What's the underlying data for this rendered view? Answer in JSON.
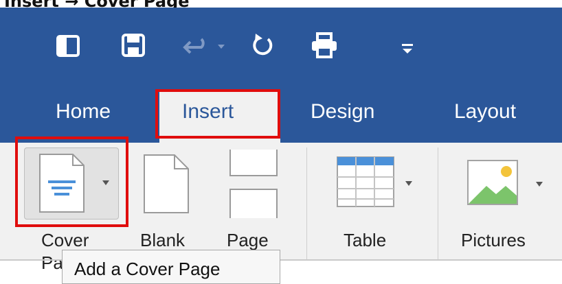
{
  "caption": "Insert → Cover Page",
  "quick_access": [
    "sidebar-icon",
    "save-icon",
    "undo-icon",
    "redo-icon",
    "print-icon",
    "customize-icon"
  ],
  "tabs": {
    "home": "Home",
    "insert": "Insert",
    "design": "Design",
    "layout": "Layout"
  },
  "ribbon": {
    "cover_page_line1": "Cover",
    "cover_page_line2": "Pa",
    "blank_page_line1": "Blank",
    "page_break_line1": "Page",
    "table": "Table",
    "pictures": "Pictures"
  },
  "tooltip": {
    "text": "Add a Cover Page"
  },
  "colors": {
    "titlebar": "#2b579a",
    "highlight": "#e00d0d",
    "ribbon": "#f1f1f1",
    "accent_blue": "#4a90d9"
  }
}
